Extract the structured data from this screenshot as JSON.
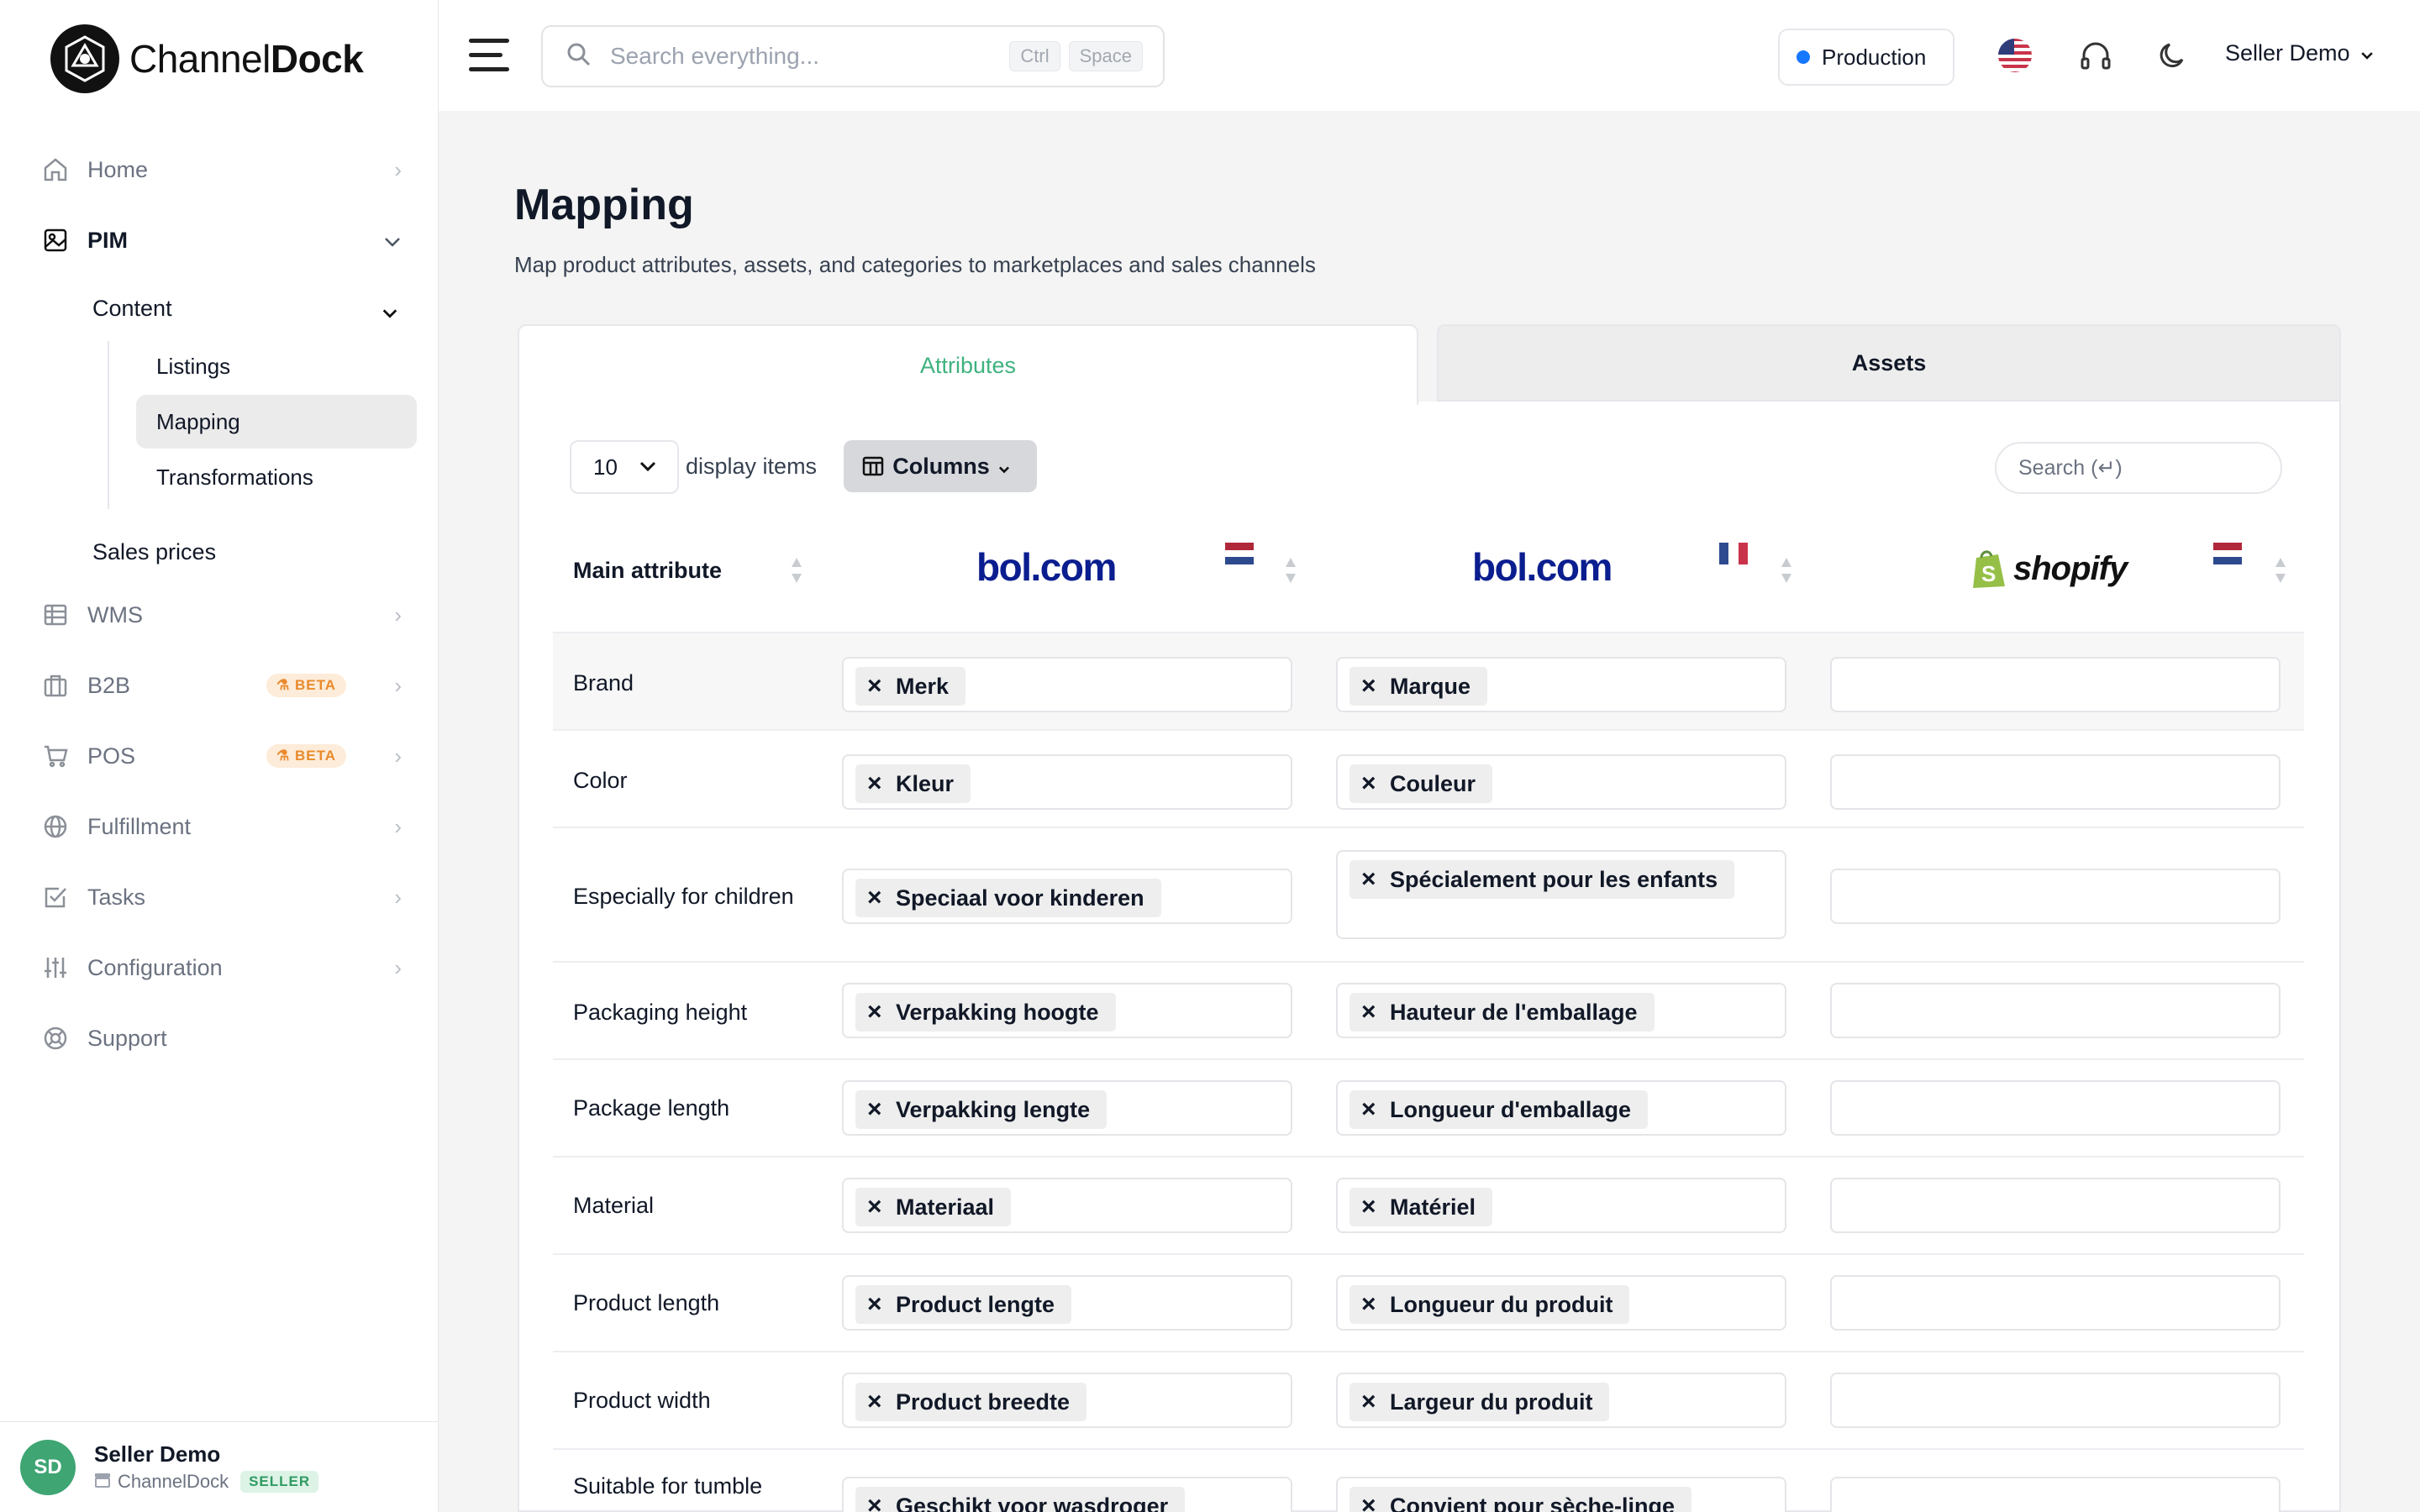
{
  "brand": {
    "name_light": "Channel",
    "name_bold": "Dock"
  },
  "search": {
    "placeholder": "Search everything...",
    "kbd1": "Ctrl",
    "kbd2": "Space"
  },
  "topbar": {
    "environment": "Production",
    "user_menu": "Seller Demo"
  },
  "sidebar": {
    "items": [
      {
        "label": "Home",
        "icon": "home-icon"
      },
      {
        "label": "PIM",
        "icon": "image-icon"
      },
      {
        "label": "WMS",
        "icon": "grid-icon"
      },
      {
        "label": "B2B",
        "icon": "building-icon",
        "badge": "BETA"
      },
      {
        "label": "POS",
        "icon": "cart-icon",
        "badge": "BETA"
      },
      {
        "label": "Fulfillment",
        "icon": "globe-icon"
      },
      {
        "label": "Tasks",
        "icon": "checkbox-icon"
      },
      {
        "label": "Configuration",
        "icon": "sliders-icon"
      },
      {
        "label": "Support",
        "icon": "lifebuoy-icon"
      }
    ],
    "pim_sub": {
      "content": "Content",
      "sales_prices": "Sales prices"
    },
    "content_sub": [
      "Listings",
      "Mapping",
      "Transformations"
    ],
    "user": {
      "initials": "SD",
      "name": "Seller Demo",
      "account": "ChannelDock",
      "role": "SELLER"
    }
  },
  "page": {
    "title": "Mapping",
    "subtitle": "Map product attributes, assets, and categories to marketplaces and sales channels",
    "tabs": [
      "Attributes",
      "Assets"
    ]
  },
  "table": {
    "per_page": "10",
    "display_label": "display items",
    "columns_button": "Columns",
    "search_placeholder": "Search (↵)",
    "header_main": "Main attribute",
    "channels": [
      {
        "logo": "bol.com",
        "flag": "nl"
      },
      {
        "logo": "bol.com",
        "flag": "fr"
      },
      {
        "logo": "shopify",
        "flag": "nl"
      }
    ],
    "rows": [
      {
        "label": "Brand",
        "bol_nl": "Merk",
        "bol_fr": "Marque"
      },
      {
        "label": "Color",
        "bol_nl": "Kleur",
        "bol_fr": "Couleur"
      },
      {
        "label": "Especially for children",
        "bol_nl": "Speciaal voor kinderen",
        "bol_fr": "Spécialement pour les enfants"
      },
      {
        "label": "Packaging height",
        "bol_nl": "Verpakking hoogte",
        "bol_fr": "Hauteur de l'emballage"
      },
      {
        "label": "Package length",
        "bol_nl": "Verpakking lengte",
        "bol_fr": "Longueur d'emballage"
      },
      {
        "label": "Material",
        "bol_nl": "Materiaal",
        "bol_fr": "Matériel"
      },
      {
        "label": "Product length",
        "bol_nl": "Product lengte",
        "bol_fr": "Longueur du produit"
      },
      {
        "label": "Product width",
        "bol_nl": "Product breedte",
        "bol_fr": "Largeur du produit"
      },
      {
        "label": "Suitable for tumble",
        "bol_nl": "Geschikt voor wasdroger",
        "bol_fr": "Convient pour sèche-linge"
      }
    ]
  },
  "colors": {
    "accent": "#3fb27f",
    "bol_blue": "#0b1e8f",
    "env_dot": "#1677ff",
    "beta": "#e98a2c"
  }
}
